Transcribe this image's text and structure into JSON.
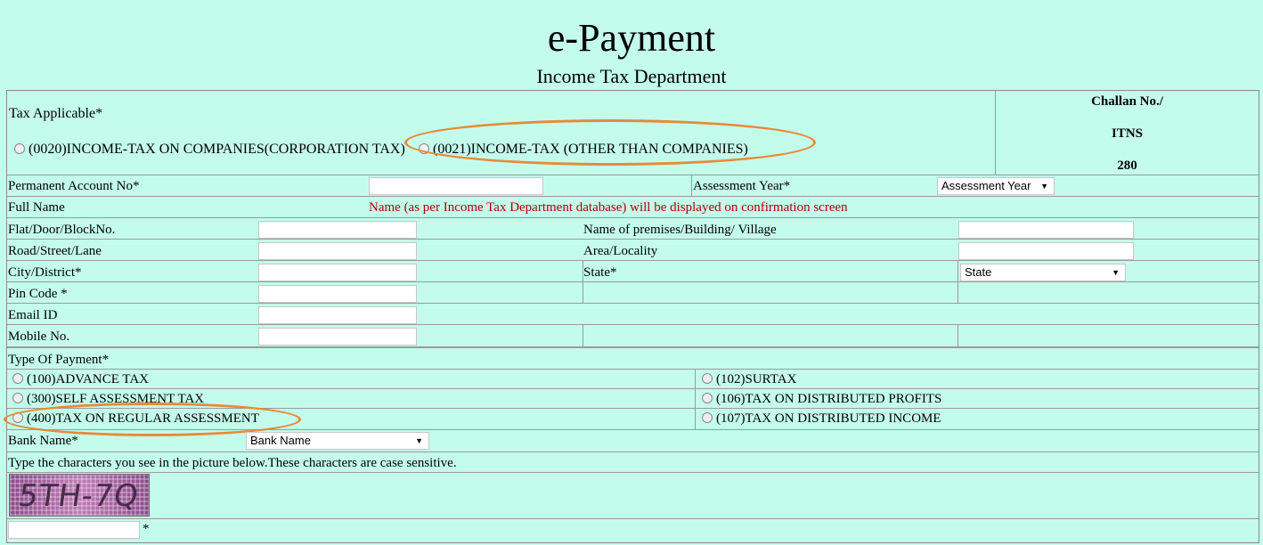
{
  "header": {
    "title": "e-Payment",
    "subtitle": "Income Tax Department"
  },
  "tax_applicable": {
    "label": "Tax Applicable*",
    "options": [
      "(0020)INCOME-TAX ON COMPANIES(CORPORATION TAX)",
      "(0021)INCOME-TAX (OTHER THAN COMPANIES)"
    ]
  },
  "challan": {
    "line1": "Challan No./",
    "line2": "ITNS",
    "line3": "280"
  },
  "pan": {
    "label": "Permanent Account No*"
  },
  "assessment_year": {
    "label": "Assessment Year*",
    "select_value": "Assessment Year"
  },
  "full_name": {
    "label": "Full Name",
    "note": "Name (as per Income Tax Department database) will be displayed on confirmation screen"
  },
  "address": {
    "flat": "Flat/Door/BlockNo.",
    "premises": "Name of premises/Building/ Village",
    "road": "Road/Street/Lane",
    "area": "Area/Locality",
    "city": "City/District*",
    "state": "State*",
    "state_select": "State",
    "pin": "Pin Code *",
    "email": "Email ID",
    "mobile": "Mobile No."
  },
  "payment_type": {
    "label": "Type Of Payment*",
    "options": [
      "(100)ADVANCE TAX",
      "(102)SURTAX",
      "(300)SELF ASSESSMENT TAX",
      "(106)TAX ON DISTRIBUTED PROFITS",
      "(400)TAX ON REGULAR ASSESSMENT",
      "(107)TAX ON DISTRIBUTED INCOME"
    ]
  },
  "bank": {
    "label": "Bank Name*",
    "select_value": "Bank Name"
  },
  "captcha": {
    "instruction": "Type the characters you see in the picture below.These characters are case sensitive.",
    "image_text": "5TH-7Q",
    "required_mark": "*"
  },
  "colors": {
    "background": "#c4fceb",
    "highlight": "#e8893a",
    "note": "#b00000"
  }
}
